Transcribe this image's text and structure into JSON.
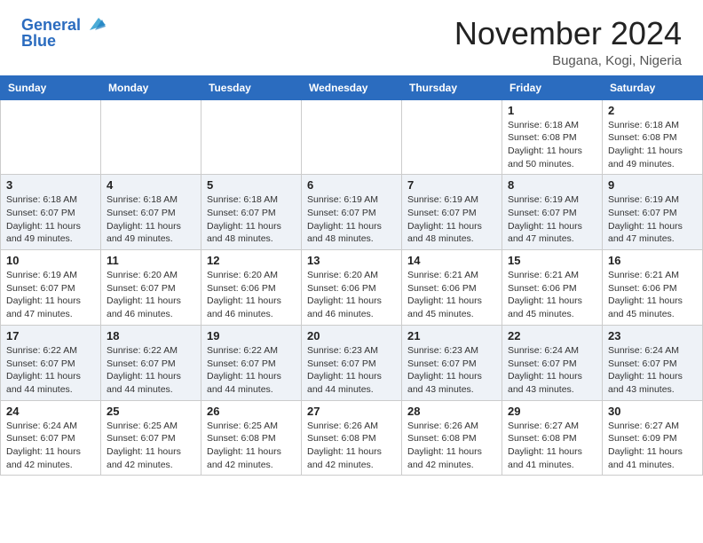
{
  "header": {
    "logo_line1": "General",
    "logo_line2": "Blue",
    "month": "November 2024",
    "location": "Bugana, Kogi, Nigeria"
  },
  "weekdays": [
    "Sunday",
    "Monday",
    "Tuesday",
    "Wednesday",
    "Thursday",
    "Friday",
    "Saturday"
  ],
  "weeks": [
    [
      {
        "day": "",
        "info": ""
      },
      {
        "day": "",
        "info": ""
      },
      {
        "day": "",
        "info": ""
      },
      {
        "day": "",
        "info": ""
      },
      {
        "day": "",
        "info": ""
      },
      {
        "day": "1",
        "info": "Sunrise: 6:18 AM\nSunset: 6:08 PM\nDaylight: 11 hours\nand 50 minutes."
      },
      {
        "day": "2",
        "info": "Sunrise: 6:18 AM\nSunset: 6:08 PM\nDaylight: 11 hours\nand 49 minutes."
      }
    ],
    [
      {
        "day": "3",
        "info": "Sunrise: 6:18 AM\nSunset: 6:07 PM\nDaylight: 11 hours\nand 49 minutes."
      },
      {
        "day": "4",
        "info": "Sunrise: 6:18 AM\nSunset: 6:07 PM\nDaylight: 11 hours\nand 49 minutes."
      },
      {
        "day": "5",
        "info": "Sunrise: 6:18 AM\nSunset: 6:07 PM\nDaylight: 11 hours\nand 48 minutes."
      },
      {
        "day": "6",
        "info": "Sunrise: 6:19 AM\nSunset: 6:07 PM\nDaylight: 11 hours\nand 48 minutes."
      },
      {
        "day": "7",
        "info": "Sunrise: 6:19 AM\nSunset: 6:07 PM\nDaylight: 11 hours\nand 48 minutes."
      },
      {
        "day": "8",
        "info": "Sunrise: 6:19 AM\nSunset: 6:07 PM\nDaylight: 11 hours\nand 47 minutes."
      },
      {
        "day": "9",
        "info": "Sunrise: 6:19 AM\nSunset: 6:07 PM\nDaylight: 11 hours\nand 47 minutes."
      }
    ],
    [
      {
        "day": "10",
        "info": "Sunrise: 6:19 AM\nSunset: 6:07 PM\nDaylight: 11 hours\nand 47 minutes."
      },
      {
        "day": "11",
        "info": "Sunrise: 6:20 AM\nSunset: 6:07 PM\nDaylight: 11 hours\nand 46 minutes."
      },
      {
        "day": "12",
        "info": "Sunrise: 6:20 AM\nSunset: 6:06 PM\nDaylight: 11 hours\nand 46 minutes."
      },
      {
        "day": "13",
        "info": "Sunrise: 6:20 AM\nSunset: 6:06 PM\nDaylight: 11 hours\nand 46 minutes."
      },
      {
        "day": "14",
        "info": "Sunrise: 6:21 AM\nSunset: 6:06 PM\nDaylight: 11 hours\nand 45 minutes."
      },
      {
        "day": "15",
        "info": "Sunrise: 6:21 AM\nSunset: 6:06 PM\nDaylight: 11 hours\nand 45 minutes."
      },
      {
        "day": "16",
        "info": "Sunrise: 6:21 AM\nSunset: 6:06 PM\nDaylight: 11 hours\nand 45 minutes."
      }
    ],
    [
      {
        "day": "17",
        "info": "Sunrise: 6:22 AM\nSunset: 6:07 PM\nDaylight: 11 hours\nand 44 minutes."
      },
      {
        "day": "18",
        "info": "Sunrise: 6:22 AM\nSunset: 6:07 PM\nDaylight: 11 hours\nand 44 minutes."
      },
      {
        "day": "19",
        "info": "Sunrise: 6:22 AM\nSunset: 6:07 PM\nDaylight: 11 hours\nand 44 minutes."
      },
      {
        "day": "20",
        "info": "Sunrise: 6:23 AM\nSunset: 6:07 PM\nDaylight: 11 hours\nand 44 minutes."
      },
      {
        "day": "21",
        "info": "Sunrise: 6:23 AM\nSunset: 6:07 PM\nDaylight: 11 hours\nand 43 minutes."
      },
      {
        "day": "22",
        "info": "Sunrise: 6:24 AM\nSunset: 6:07 PM\nDaylight: 11 hours\nand 43 minutes."
      },
      {
        "day": "23",
        "info": "Sunrise: 6:24 AM\nSunset: 6:07 PM\nDaylight: 11 hours\nand 43 minutes."
      }
    ],
    [
      {
        "day": "24",
        "info": "Sunrise: 6:24 AM\nSunset: 6:07 PM\nDaylight: 11 hours\nand 42 minutes."
      },
      {
        "day": "25",
        "info": "Sunrise: 6:25 AM\nSunset: 6:07 PM\nDaylight: 11 hours\nand 42 minutes."
      },
      {
        "day": "26",
        "info": "Sunrise: 6:25 AM\nSunset: 6:08 PM\nDaylight: 11 hours\nand 42 minutes."
      },
      {
        "day": "27",
        "info": "Sunrise: 6:26 AM\nSunset: 6:08 PM\nDaylight: 11 hours\nand 42 minutes."
      },
      {
        "day": "28",
        "info": "Sunrise: 6:26 AM\nSunset: 6:08 PM\nDaylight: 11 hours\nand 42 minutes."
      },
      {
        "day": "29",
        "info": "Sunrise: 6:27 AM\nSunset: 6:08 PM\nDaylight: 11 hours\nand 41 minutes."
      },
      {
        "day": "30",
        "info": "Sunrise: 6:27 AM\nSunset: 6:09 PM\nDaylight: 11 hours\nand 41 minutes."
      }
    ]
  ]
}
